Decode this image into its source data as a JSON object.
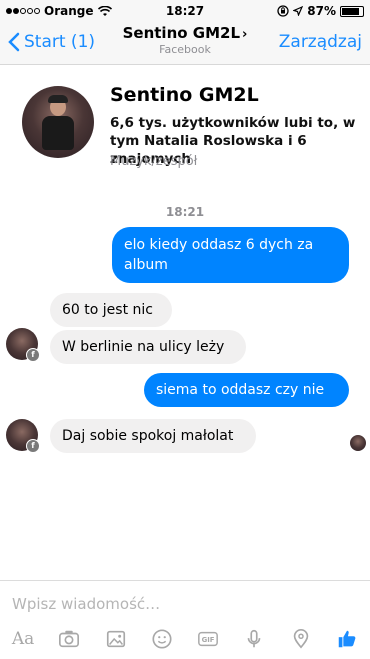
{
  "status_bar": {
    "carrier": "Orange",
    "time": "18:27",
    "battery": "87%",
    "battery_fraction": 0.87
  },
  "nav": {
    "back_label": "Start (1)",
    "title": "Sentino GM2L",
    "chevron": "›",
    "subtitle": "Facebook",
    "right_label": "Zarządzaj"
  },
  "profile": {
    "name": "Sentino GM2L",
    "likes": "6,6 tys. użytkowników lubi to, w tym Natalia Roslowska i 6 znajomych",
    "category": "Muzyk/zespół"
  },
  "conversation": {
    "timestamp": "18:21",
    "messages": [
      {
        "direction": "out",
        "text": "elo kiedy oddasz 6 dych za album"
      },
      {
        "direction": "in",
        "text": "60 to jest nic"
      },
      {
        "direction": "in",
        "text": "W berlinie na ulicy leży"
      },
      {
        "direction": "out",
        "text": "siema to oddasz czy nie"
      },
      {
        "direction": "in",
        "text": "Daj sobie spokoj małolat"
      }
    ]
  },
  "composer": {
    "placeholder": "Wpisz wiadomość…",
    "toolbar_icons": [
      "text-format-icon",
      "camera-icon",
      "gallery-icon",
      "emoji-icon",
      "gif-icon",
      "microphone-icon",
      "location-pin-icon",
      "thumbs-up-icon"
    ],
    "aa_label": "Aa",
    "gif_label": "GIF"
  },
  "colors": {
    "accent": "#1a8cff",
    "outgoing_bubble": "#0084ff",
    "incoming_bubble": "#f1f0f0",
    "muted": "#8e8e93"
  }
}
